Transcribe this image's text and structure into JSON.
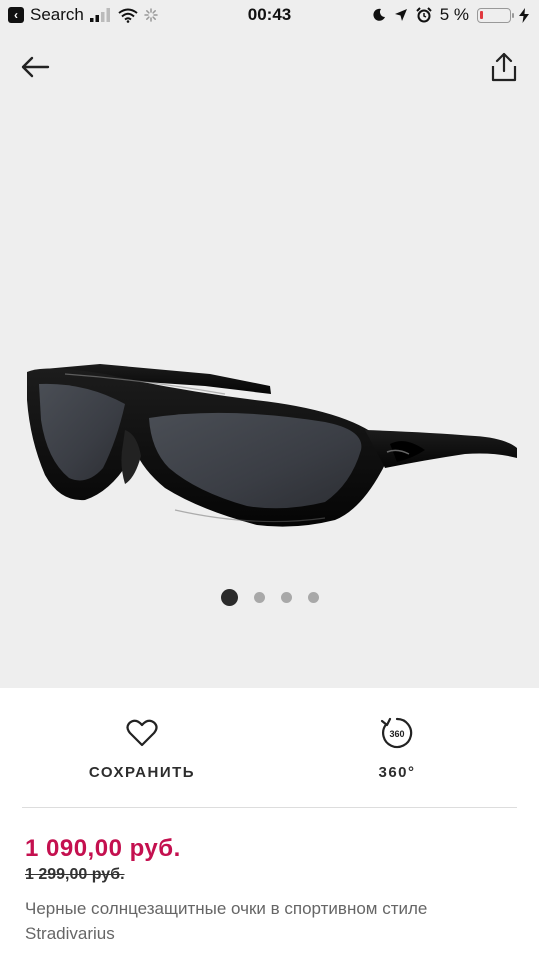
{
  "status_bar": {
    "back_app_label": "Search",
    "time": "00:43",
    "battery_percent": "5 %"
  },
  "carousel": {
    "slide_count": 4,
    "active_index": 0
  },
  "actions": {
    "save_label": "СОХРАНИТЬ",
    "view360_label": "360°",
    "view360_badge": "360"
  },
  "product": {
    "price": "1 090,00 руб.",
    "old_price": "1 299,00 руб.",
    "name": "Черные солнцезащитные очки в спортивном стиле Stradivarius"
  },
  "colors": {
    "sale_price": "#c4104f",
    "hero_background": "#eeeeee",
    "dot_active": "#2b2b2b",
    "dot_inactive": "#a8a8a8"
  }
}
